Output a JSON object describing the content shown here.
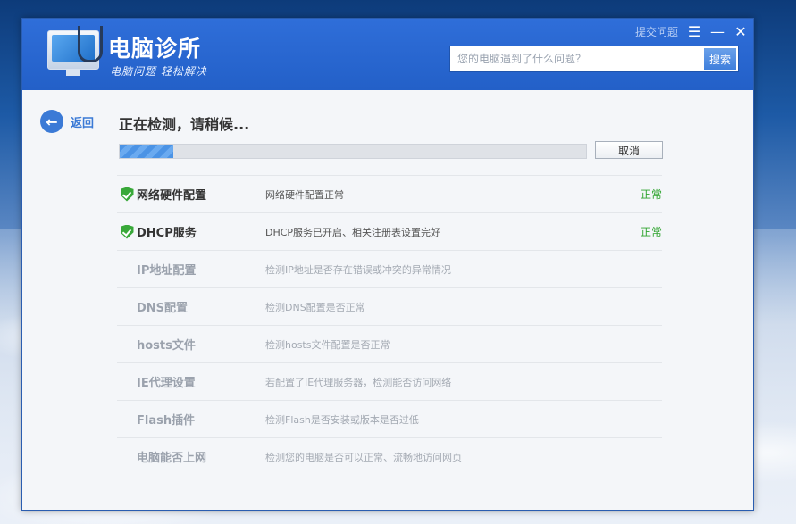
{
  "app": {
    "title": "电脑诊所",
    "subtitle": "电脑问题 轻松解决"
  },
  "header": {
    "feedback_label": "提交问题",
    "menu_icon": "menu-icon",
    "minimize_icon": "minimize-icon",
    "close_icon": "close-icon",
    "search": {
      "placeholder": "您的电脑遇到了什么问题？",
      "button_label": "搜索"
    }
  },
  "nav": {
    "back_label": "返回",
    "back_icon": "arrow-left-icon"
  },
  "scan": {
    "status_title": "正在检测，请稍候...",
    "progress_fraction": 0.115,
    "cancel_label": "取消"
  },
  "colors": {
    "header_blue": "#2d6ad6",
    "accent": "#3b7ad6",
    "success": "#2fa42f"
  },
  "items": [
    {
      "name": "网络硬件配置",
      "desc": "网络硬件配置正常",
      "status": "正常",
      "state": "done"
    },
    {
      "name": "DHCP服务",
      "desc": "DHCP服务已开启、相关注册表设置完好",
      "status": "正常",
      "state": "done"
    },
    {
      "name": "IP地址配置",
      "desc": "检测IP地址是否存在错误或冲突的异常情况",
      "status": "",
      "state": "pending"
    },
    {
      "name": "DNS配置",
      "desc": "检测DNS配置是否正常",
      "status": "",
      "state": "pending"
    },
    {
      "name": "hosts文件",
      "desc": "检测hosts文件配置是否正常",
      "status": "",
      "state": "pending"
    },
    {
      "name": "IE代理设置",
      "desc": "若配置了IE代理服务器，检测能否访问网络",
      "status": "",
      "state": "pending"
    },
    {
      "name": "Flash插件",
      "desc": "检测Flash是否安装或版本是否过低",
      "status": "",
      "state": "pending"
    },
    {
      "name": "电脑能否上网",
      "desc": "检测您的电脑是否可以正常、流畅地访问网页",
      "status": "",
      "state": "pending"
    }
  ]
}
